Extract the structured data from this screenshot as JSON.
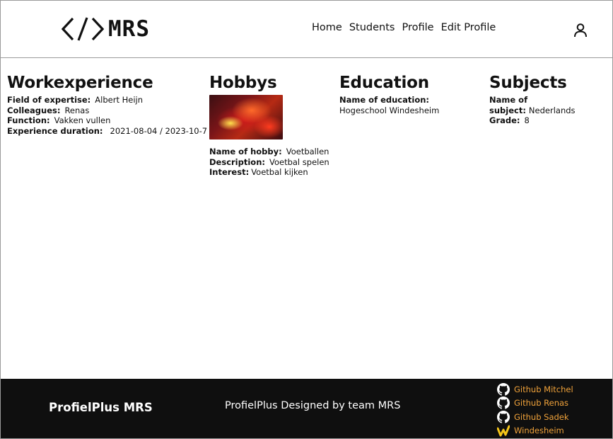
{
  "header": {
    "logo_text": "MRS",
    "nav": [
      "Home",
      "Students",
      "Profile",
      "Edit Profile"
    ]
  },
  "workexperience": {
    "title": "Workexperience",
    "rows": [
      {
        "label": "Field of expertise:",
        "value": "Albert Heijn"
      },
      {
        "label": "Colleagues:",
        "value": "Renas"
      },
      {
        "label": "Function:",
        "value": "Vakken vullen"
      },
      {
        "label": "Experience duration:",
        "value": "2021-08-04 / 2023-10-7"
      }
    ]
  },
  "hobbys": {
    "title": "Hobbys",
    "rows": [
      {
        "label": "Name of hobby:",
        "value": "Voetballen"
      },
      {
        "label": "Description:",
        "value": "Voetbal spelen"
      },
      {
        "label": "Interest:",
        "value": "Voetbal kijken"
      }
    ]
  },
  "education": {
    "title": "Education",
    "label": "Name of education:",
    "value": "Hogeschool Windesheim"
  },
  "subjects": {
    "title": "Subjects",
    "rows": [
      {
        "label": "Name of subject:",
        "value": "Nederlands"
      },
      {
        "label": "Grade:",
        "value": "8"
      }
    ]
  },
  "footer": {
    "brand": "ProfielPlus MRS",
    "credit": "ProfielPlus Designed by team MRS",
    "links": [
      {
        "label": "Github Mitchel",
        "icon": "github-icon"
      },
      {
        "label": "Github Renas",
        "icon": "github-icon"
      },
      {
        "label": "Github Sadek",
        "icon": "github-icon"
      },
      {
        "label": "Windesheim",
        "icon": "windesheim-icon"
      }
    ],
    "link_color": "#f0a23a"
  }
}
